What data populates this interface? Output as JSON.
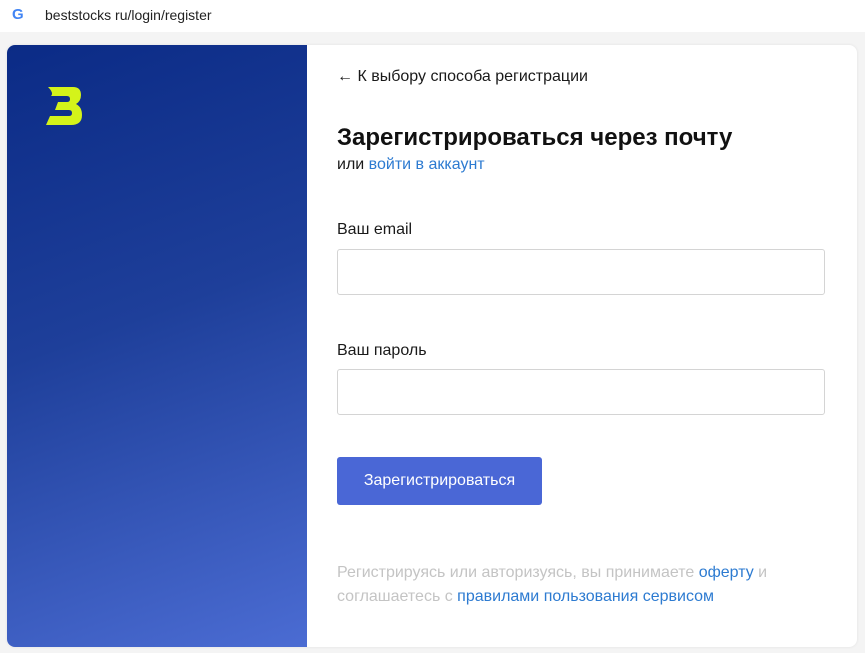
{
  "browser": {
    "url": "beststocks ru/login/register",
    "favicon": "google-g-icon"
  },
  "brand": {
    "logo_letter": "3",
    "logo_color": "#d4f31a"
  },
  "form": {
    "back_link": "← К выбору способа регистрации",
    "title": "Зарегистрироваться через почту",
    "alt_prefix": "или",
    "alt_link": "войти в аккаунт",
    "email_label": "Ваш email",
    "email_value": "",
    "password_label": "Ваш пароль",
    "password_value": "",
    "submit_label": "Зарегистрироваться"
  },
  "legal": {
    "text1": "Регистрируясь или авторизуясь, вы принимаете ",
    "offer_link": "оферту",
    "text2": " и соглашаетесь с ",
    "rules_link": "правилами пользования сервисом"
  },
  "colors": {
    "accent": "#4a67d6",
    "link": "#2d7bd1",
    "panel_dark": "#0b2b86",
    "panel_light": "#4b6cd3"
  }
}
